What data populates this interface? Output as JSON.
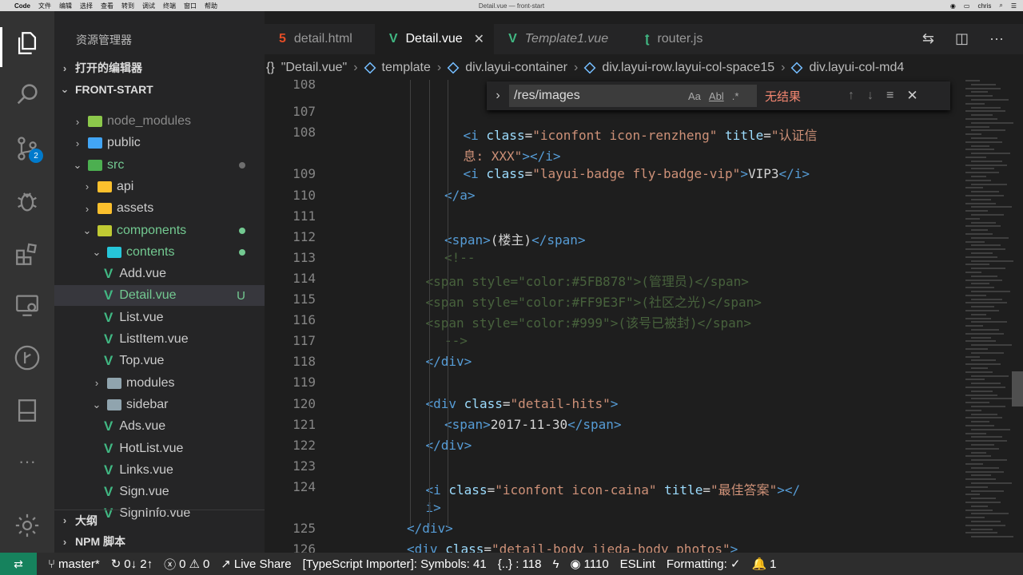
{
  "mac_menu": {
    "app": "Code",
    "items": [
      "文件",
      "编辑",
      "选择",
      "查看",
      "转到",
      "调试",
      "终端",
      "窗口",
      "帮助"
    ],
    "window_title": "Detail.vue — front-start",
    "user": "chris"
  },
  "activity_bar": {
    "scm_badge": "2",
    "icons": [
      "files-icon",
      "search-icon",
      "source-control-icon",
      "debug-icon",
      "extensions-icon",
      "remote-explorer-icon",
      "git-graph-icon",
      "bookmark-icon",
      "more-icon",
      "settings-gear-icon"
    ]
  },
  "explorer": {
    "title": "资源管理器",
    "open_editors": "打开的编辑器",
    "root": "FRONT-START",
    "tree": [
      {
        "label": "node_modules",
        "chev": "›",
        "depth": 1,
        "icon": "folder-node",
        "dim": true
      },
      {
        "label": "public",
        "chev": "›",
        "depth": 1,
        "icon": "folder-public"
      },
      {
        "label": "src",
        "chev": "⌄",
        "depth": 1,
        "icon": "folder-src",
        "dot": "gray",
        "color": "#73c991"
      },
      {
        "label": "api",
        "chev": "›",
        "depth": 2,
        "icon": "folder-api"
      },
      {
        "label": "assets",
        "chev": "›",
        "depth": 2,
        "icon": "folder-assets"
      },
      {
        "label": "components",
        "chev": "⌄",
        "depth": 2,
        "icon": "folder-components",
        "dot": "green",
        "color": "#73c991"
      },
      {
        "label": "contents",
        "chev": "⌄",
        "depth": 3,
        "icon": "folder-contents",
        "dot": "green",
        "color": "#73c991"
      },
      {
        "label": "Add.vue",
        "depth": 4,
        "vue": true
      },
      {
        "label": "Detail.vue",
        "depth": 4,
        "vue": true,
        "status": "U",
        "selected": true,
        "color": "#73c991"
      },
      {
        "label": "List.vue",
        "depth": 4,
        "vue": true
      },
      {
        "label": "ListItem.vue",
        "depth": 4,
        "vue": true
      },
      {
        "label": "Top.vue",
        "depth": 4,
        "vue": true
      },
      {
        "label": "modules",
        "chev": "›",
        "depth": 3,
        "icon": "folder-modules"
      },
      {
        "label": "sidebar",
        "chev": "⌄",
        "depth": 3,
        "icon": "folder-sidebar"
      },
      {
        "label": "Ads.vue",
        "depth": 4,
        "vue": true
      },
      {
        "label": "HotList.vue",
        "depth": 4,
        "vue": true
      },
      {
        "label": "Links.vue",
        "depth": 4,
        "vue": true
      },
      {
        "label": "Sign.vue",
        "depth": 4,
        "vue": true
      },
      {
        "label": "SignInfo.vue",
        "depth": 4,
        "vue": true
      }
    ],
    "outline": "大纲",
    "npm_scripts": "NPM 脚本"
  },
  "tabs": [
    {
      "label": "detail.html",
      "icon": "html5-icon",
      "icon_char": "5",
      "icon_color": "#e44d26",
      "active": false
    },
    {
      "label": "Detail.vue",
      "icon": "vue-icon",
      "icon_char": "V",
      "icon_color": "#41b883",
      "active": true
    },
    {
      "label": "Template1.vue",
      "icon": "vue-icon",
      "icon_char": "V",
      "icon_color": "#41b883",
      "active": false,
      "italic": true
    },
    {
      "label": "router.js",
      "icon": "router-icon",
      "icon_char": "ʈ",
      "icon_color": "#41b883",
      "active": false
    }
  ],
  "breadcrumb": {
    "file": "\"Detail.vue\"",
    "items": [
      "template",
      "div.layui-container",
      "div.layui-row.layui-col-space15",
      "div.layui-col-md4"
    ]
  },
  "find_widget": {
    "query": "/res/images",
    "opt_case": "Aa",
    "opt_word": "Abl",
    "opt_regex": ".*",
    "result": "无结果"
  },
  "code": [
    {
      "n": "108",
      "indent": 0,
      "segs": []
    },
    {
      "n": "107",
      "indent": 0,
      "segs": []
    },
    {
      "n": "108",
      "indent": 14,
      "segs": [
        [
          "tag",
          "<i "
        ],
        [
          "attr",
          "class"
        ],
        [
          "txt",
          "="
        ],
        [
          "str",
          "\"iconfont icon-renzheng\""
        ],
        [
          "txt",
          " "
        ],
        [
          "attr",
          "title"
        ],
        [
          "txt",
          "="
        ],
        [
          "str",
          "\"认证信"
        ]
      ]
    },
    {
      "n": "",
      "indent": 14,
      "segs": [
        [
          "str",
          "息: XXX\""
        ],
        [
          "tag",
          ">"
        ],
        [
          "tag",
          "</i>"
        ]
      ]
    },
    {
      "n": "109",
      "indent": 14,
      "segs": [
        [
          "tag",
          "<i "
        ],
        [
          "attr",
          "class"
        ],
        [
          "txt",
          "="
        ],
        [
          "str",
          "\"layui-badge fly-badge-vip\""
        ],
        [
          "tag",
          ">"
        ],
        [
          "txt",
          "VIP3"
        ],
        [
          "tag",
          "</i>"
        ]
      ]
    },
    {
      "n": "110",
      "indent": 12,
      "segs": [
        [
          "tag",
          "</a>"
        ]
      ]
    },
    {
      "n": "111",
      "indent": 0,
      "segs": []
    },
    {
      "n": "112",
      "indent": 12,
      "segs": [
        [
          "tag",
          "<span>"
        ],
        [
          "txt",
          "(楼主)"
        ],
        [
          "tag",
          "</span>"
        ]
      ]
    },
    {
      "n": "113",
      "indent": 12,
      "segs": [
        [
          "cmt",
          "<!--"
        ]
      ]
    },
    {
      "n": "114",
      "indent": 10,
      "segs": [
        [
          "cmt",
          "<span style=\"color:#5FB878\">(管理员)</span>"
        ]
      ]
    },
    {
      "n": "115",
      "indent": 10,
      "segs": [
        [
          "cmt",
          "<span style=\"color:#FF9E3F\">(社区之光)</span>"
        ]
      ]
    },
    {
      "n": "116",
      "indent": 10,
      "segs": [
        [
          "cmt",
          "<span style=\"color:#999\">(该号已被封)</span>"
        ]
      ]
    },
    {
      "n": "117",
      "indent": 12,
      "segs": [
        [
          "cmt",
          "-->"
        ]
      ]
    },
    {
      "n": "118",
      "indent": 10,
      "segs": [
        [
          "tag",
          "</div>"
        ]
      ]
    },
    {
      "n": "119",
      "indent": 0,
      "segs": []
    },
    {
      "n": "120",
      "indent": 10,
      "segs": [
        [
          "tag",
          "<div "
        ],
        [
          "attr",
          "class"
        ],
        [
          "txt",
          "="
        ],
        [
          "str",
          "\"detail-hits\""
        ],
        [
          "tag",
          ">"
        ]
      ]
    },
    {
      "n": "121",
      "indent": 12,
      "segs": [
        [
          "tag",
          "<span>"
        ],
        [
          "txt",
          "2017-11-30"
        ],
        [
          "tag",
          "</span>"
        ]
      ]
    },
    {
      "n": "122",
      "indent": 10,
      "segs": [
        [
          "tag",
          "</div>"
        ]
      ]
    },
    {
      "n": "123",
      "indent": 0,
      "segs": []
    },
    {
      "n": "124",
      "indent": 10,
      "segs": [
        [
          "tag",
          "<i "
        ],
        [
          "attr",
          "class"
        ],
        [
          "txt",
          "="
        ],
        [
          "str",
          "\"iconfont icon-caina\""
        ],
        [
          "txt",
          " "
        ],
        [
          "attr",
          "title"
        ],
        [
          "txt",
          "="
        ],
        [
          "str",
          "\"最佳答案\""
        ],
        [
          "tag",
          "></"
        ]
      ]
    },
    {
      "n": "",
      "indent": 10,
      "segs": [
        [
          "tag",
          "i>"
        ]
      ]
    },
    {
      "n": "125",
      "indent": 8,
      "segs": [
        [
          "tag",
          "</div>"
        ]
      ]
    },
    {
      "n": "126",
      "indent": 8,
      "segs": [
        [
          "tag",
          "<div "
        ],
        [
          "attr",
          "class"
        ],
        [
          "txt",
          "="
        ],
        [
          "str",
          "\"detail-body jieda-body photos\""
        ],
        [
          "tag",
          ">"
        ]
      ]
    }
  ],
  "statusbar": {
    "branch": "master*",
    "sync": "0↓ 2↑",
    "errors": "0",
    "warnings": "0",
    "live_share": "Live Share",
    "ts_importer": "[TypeScript Importer]: Symbols: 41",
    "symbols": "{..} : 118",
    "views": "1110",
    "eslint": "ESLint",
    "formatting": "Formatting: ✓",
    "notifications": "1"
  },
  "colors": {
    "accent": "#007acc",
    "vue_green": "#41b883",
    "git_untracked": "#73c991"
  }
}
